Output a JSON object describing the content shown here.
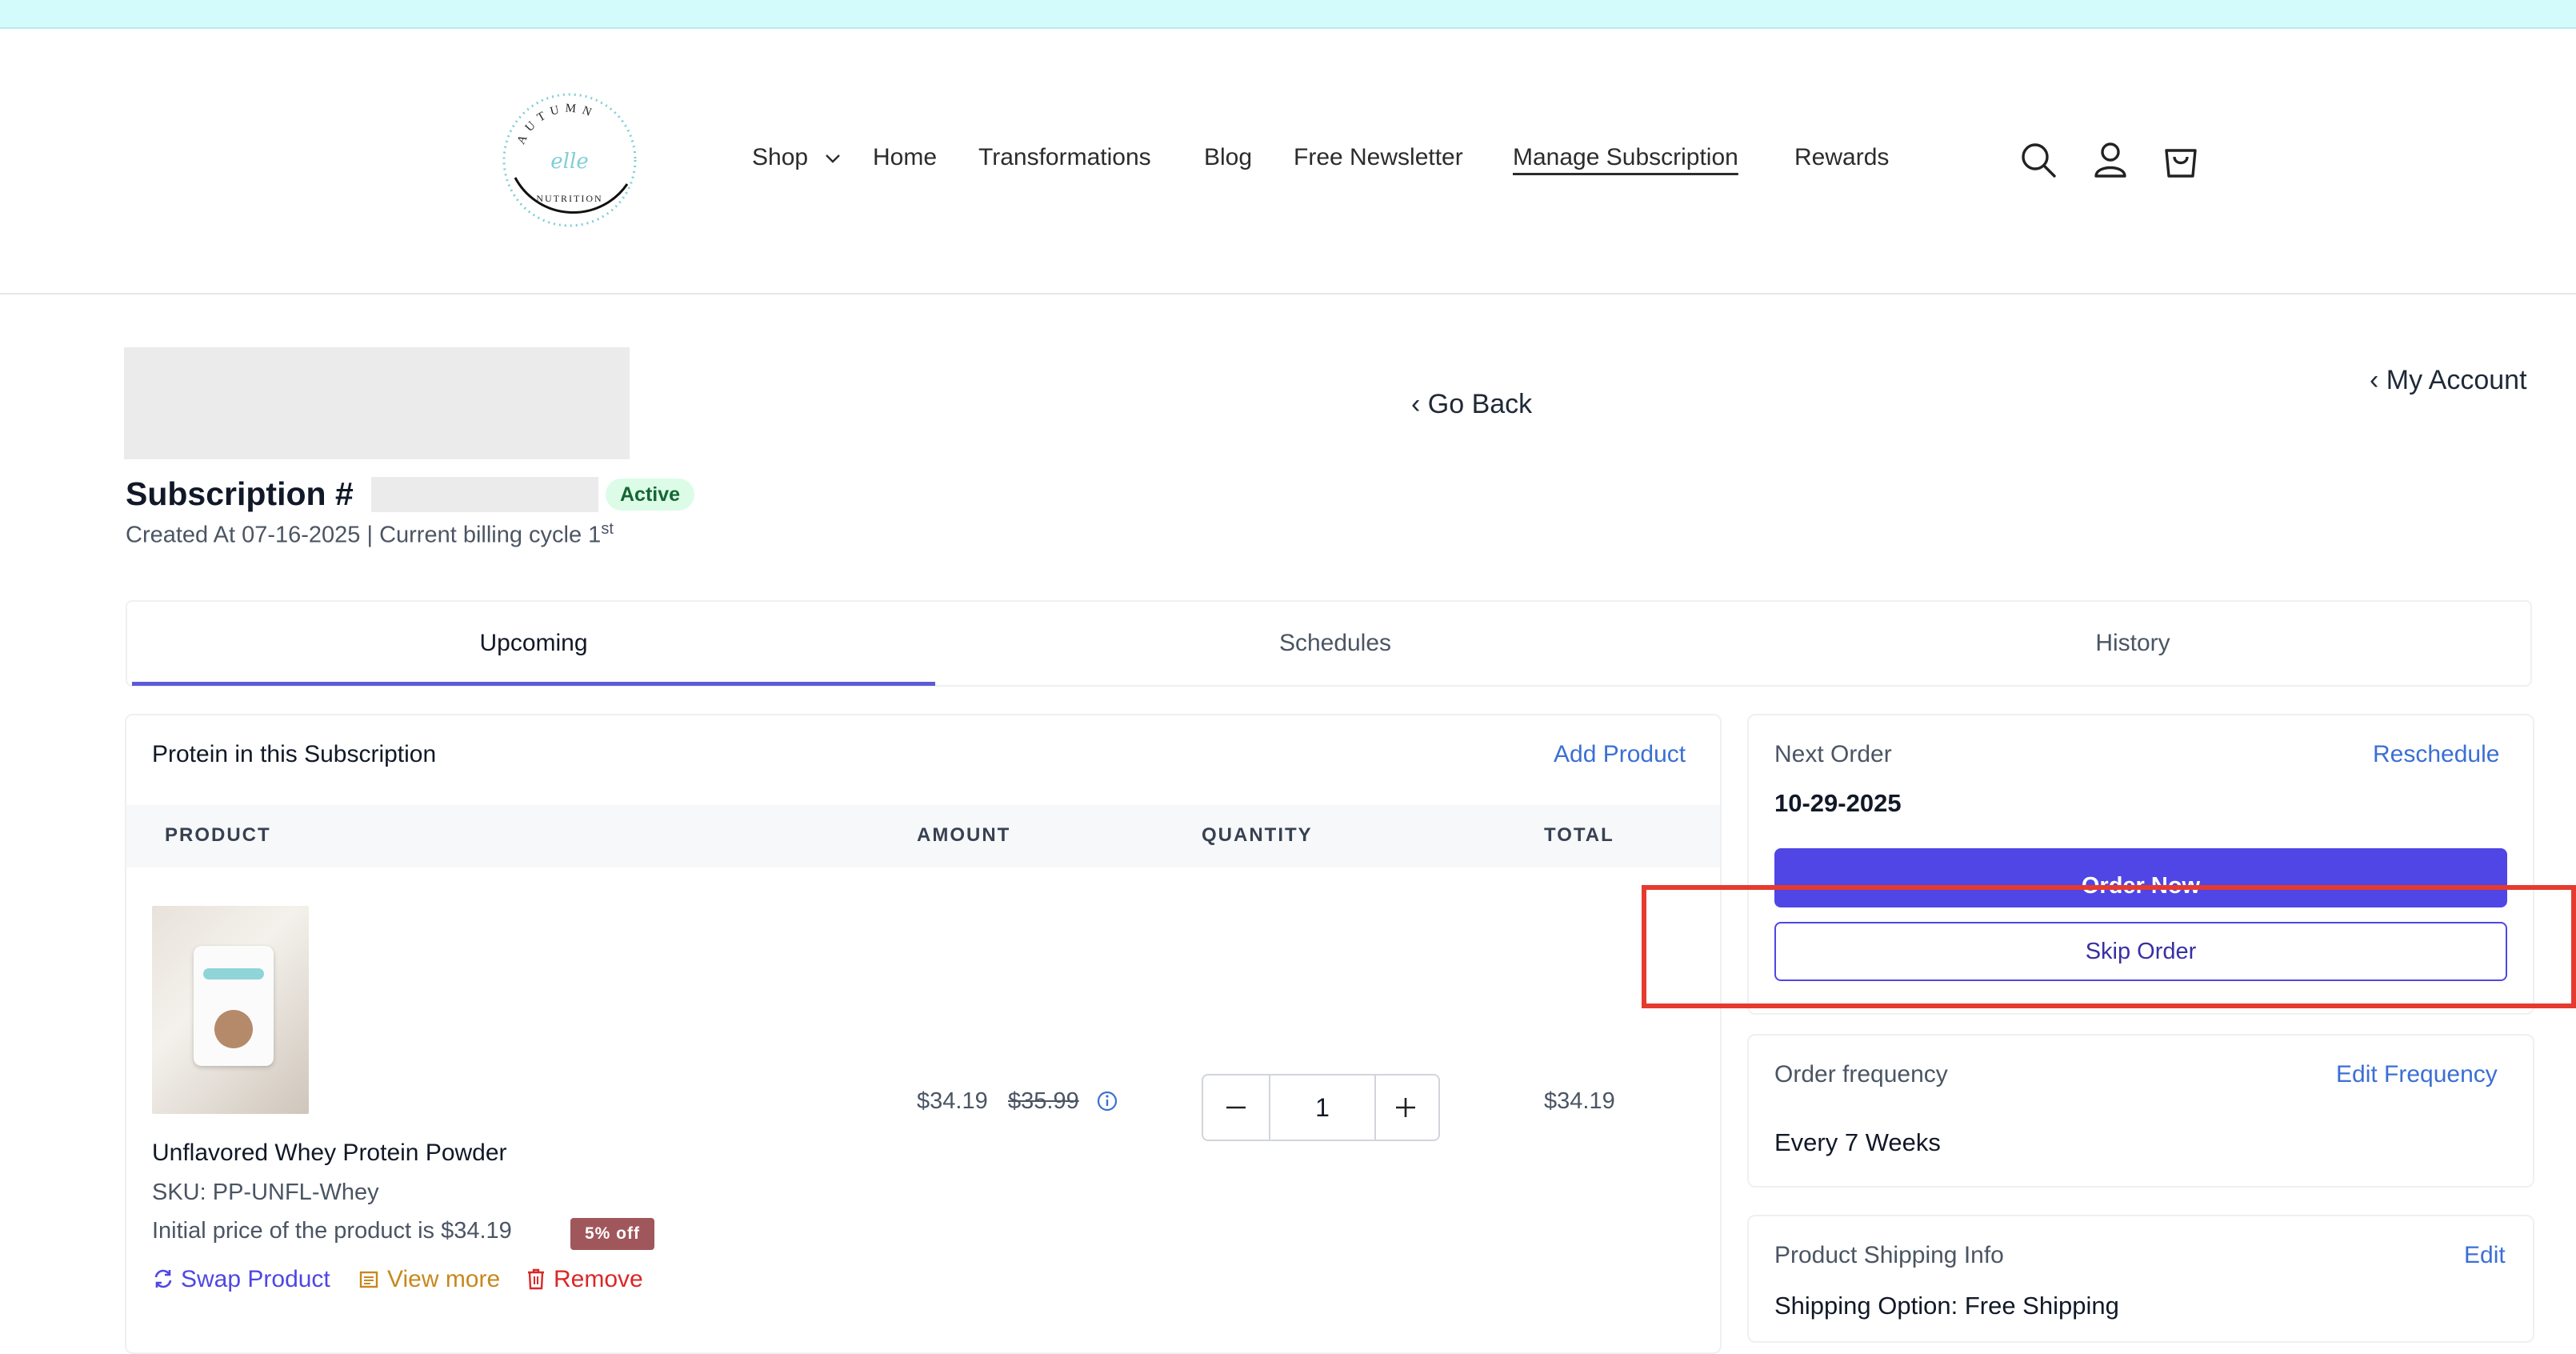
{
  "nav": {
    "shop": "Shop",
    "home": "Home",
    "transformations": "Transformations",
    "blog": "Blog",
    "newsletter": "Free Newsletter",
    "manage": "Manage Subscription",
    "rewards": "Rewards"
  },
  "logo": {
    "top_text": "AUTUMN",
    "script_text": "elle",
    "bottom_text": "NUTRITION"
  },
  "page": {
    "go_back": "‹ Go Back",
    "my_account": "‹ My Account",
    "subscription_label": "Subscription #",
    "status": "Active",
    "created_line": "Created At 07-16-2025 | Current billing cycle 1",
    "billing_suffix": "st"
  },
  "tabs": [
    "Upcoming",
    "Schedules",
    "History"
  ],
  "products_card": {
    "title": "Protein in this Subscription",
    "add_product": "Add Product",
    "columns": [
      "PRODUCT",
      "AMOUNT",
      "QUANTITY",
      "TOTAL"
    ],
    "item": {
      "name": "Unflavored Whey Protein Powder",
      "sku": "SKU: PP-UNFL-Whey",
      "initial_price": "Initial price of the product is $34.19",
      "discount_badge": "5% off",
      "price": "$34.19",
      "original_price": "$35.99",
      "quantity": "1",
      "total": "$34.19"
    },
    "actions": {
      "swap": "Swap Product",
      "view_more": "View more",
      "remove": "Remove"
    }
  },
  "next_order": {
    "label": "Next Order",
    "reschedule": "Reschedule",
    "date": "10-29-2025",
    "order_now": "Order Now",
    "skip": "Skip Order"
  },
  "frequency": {
    "label": "Order frequency",
    "edit": "Edit Frequency",
    "value": "Every 7 Weeks"
  },
  "shipping": {
    "label": "Product Shipping Info",
    "edit": "Edit",
    "option": "Shipping Option: Free Shipping"
  },
  "colors": {
    "accent": "#4f46e5",
    "link": "#3b6fd4",
    "highlight": "#e53b2f",
    "view_more": "#c8881d",
    "remove": "#dc2626"
  }
}
